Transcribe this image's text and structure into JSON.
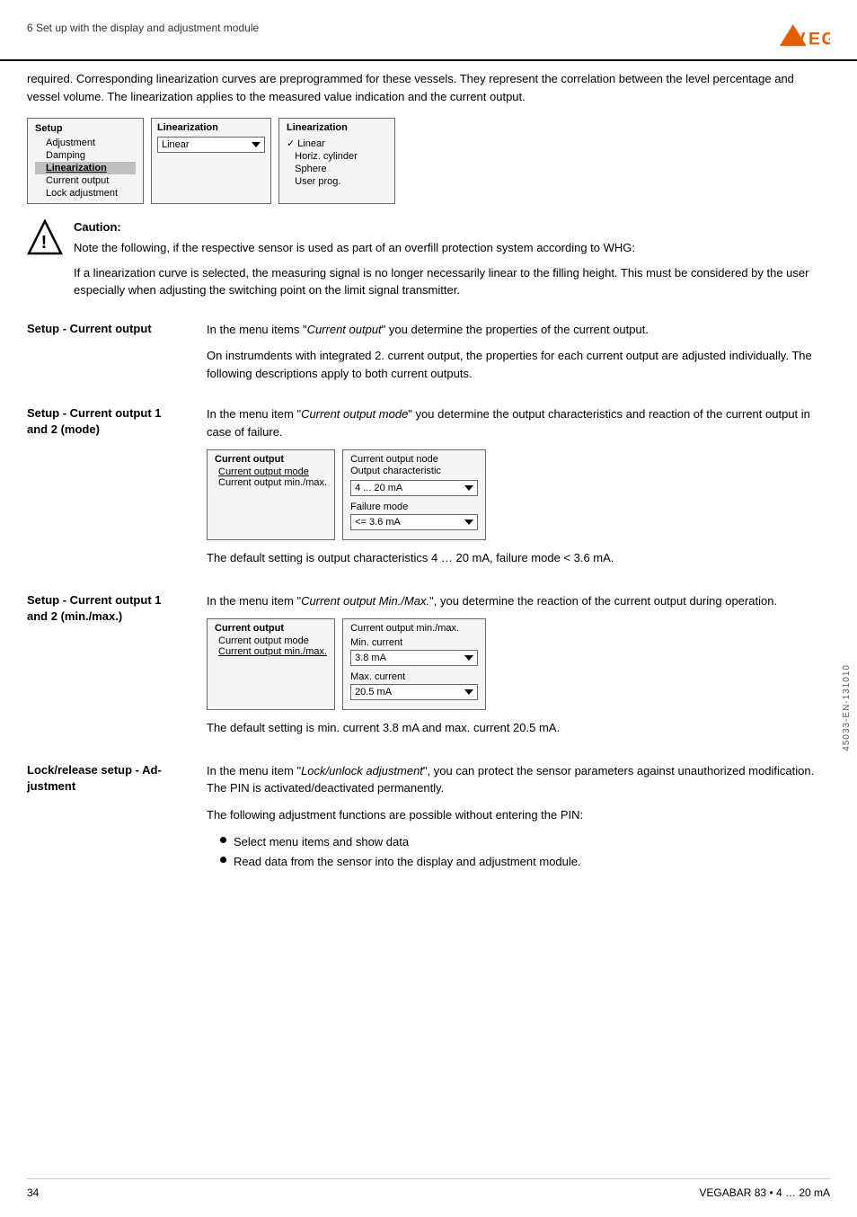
{
  "header": {
    "section_title": "6 Set up with the display and adjustment module",
    "logo_text": "VEGA"
  },
  "intro": {
    "paragraph": "required. Corresponding linearization curves are preprogrammed for these vessels. They represent the correlation between the level percentage and vessel volume. The linearization applies to the measured value indication and the current output."
  },
  "setup_panel": {
    "title": "Setup",
    "items": [
      "Adjustment",
      "Damping",
      "Linearization",
      "Current output",
      "Lock adjustment"
    ],
    "selected_item": "Linearization"
  },
  "linearization_panel": {
    "label": "Linearization",
    "value": "Linear"
  },
  "linearization_options": {
    "label": "Linearization",
    "options": [
      "Linear",
      "Horiz. cylinder",
      "Sphere",
      "User prog."
    ],
    "selected": "Linear"
  },
  "caution": {
    "title": "Caution:",
    "para1": "Note the following, if the respective sensor is used as part of an overfill protection system according to WHG:",
    "para2": "If a linearization curve is selected, the measuring signal is no longer necessarily linear to the filling height. This must be considered by the user especially when adjusting the switching point on the limit signal transmitter."
  },
  "section_current_output": {
    "label": "Setup - Current output",
    "para1": "In the menu items \"Current output\" you determine the properties of the current output.",
    "para2": "On instrumdents with integrated 2. current output, the properties for each current output are adjusted individually. The following descriptions apply to both current outputs."
  },
  "section_current_output_mode": {
    "label1": "Setup - Current output 1",
    "label2": "and 2 (mode)",
    "para": "In the menu item \"Current output mode\" you determine the output characteristics and reaction of the current output in case of failure.",
    "panel_left_title": "Current output",
    "panel_left_items": [
      "Current output mode",
      "Current output min./max."
    ],
    "panel_right_label1": "Current output node",
    "panel_right_label2": "Output characteristic",
    "field1_label": "Output characteristic",
    "field1_value": "4 ... 20 mA",
    "field2_label": "Failure mode",
    "field2_value": "<= 3.6 mA",
    "default_text": "The default setting is output characteristics 4 … 20 mA, failure mode < 3.6 mA."
  },
  "section_current_minmax": {
    "label1": "Setup - Current output 1",
    "label2": "and 2 (min./max.)",
    "para": "In the menu item \"Current output Min./Max.\", you determine the reaction of the current output during operation.",
    "panel_left_title": "Current output",
    "panel_left_items": [
      "Current output mode",
      "Current output min./max."
    ],
    "panel_right_title": "Current output min./max.",
    "field1_label": "Min. current",
    "field1_value": "3.8 mA",
    "field2_label": "Max. current",
    "field2_value": "20.5 mA",
    "default_text": "The default setting is min. current 3.8 mA and max. current 20.5 mA."
  },
  "section_lock": {
    "label1": "Lock/release setup - Ad-",
    "label2": "justment",
    "para1": "In the menu item \"Lock/unlock adjustment\", you can protect the sensor parameters against unauthorized modification. The PIN is activated/deactivated permanently.",
    "para2": "The following adjustment functions are possible without entering the PIN:",
    "bullets": [
      "Select menu items and show data",
      "Read data from the sensor into the display and adjustment module."
    ]
  },
  "footer": {
    "page_number": "34",
    "product_info": "VEGABAR 83 • 4 … 20 mA"
  },
  "vertical_text": "45033-EN-131010"
}
